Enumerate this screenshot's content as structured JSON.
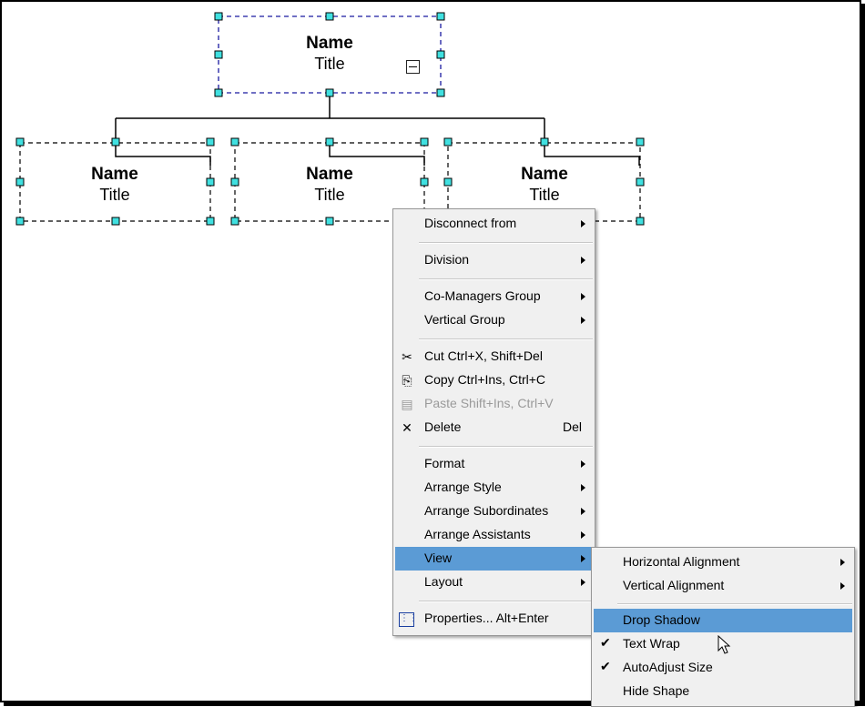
{
  "org_chart": {
    "top_node": {
      "name": "Name",
      "title": "Title"
    },
    "children": [
      {
        "name": "Name",
        "title": "Title"
      },
      {
        "name": "Name",
        "title": "Title"
      },
      {
        "name": "Name",
        "title": "Title"
      }
    ]
  },
  "context_menu": {
    "items": {
      "disconnect": "Disconnect from",
      "division": "Division",
      "co_managers": "Co-Managers Group",
      "vertical_group": "Vertical Group",
      "cut": "Cut  Ctrl+X, Shift+Del",
      "copy": "Copy  Ctrl+Ins, Ctrl+C",
      "paste": "Paste Shift+Ins, Ctrl+V",
      "delete": "Delete",
      "delete_shortcut": "Del",
      "format": "Format",
      "arrange_style": "Arrange Style",
      "arrange_subordinates": "Arrange Subordinates",
      "arrange_assistants": "Arrange Assistants",
      "view": "View",
      "layout": "Layout",
      "properties": "Properties...  Alt+Enter"
    }
  },
  "view_submenu": {
    "items": {
      "horizontal_alignment": "Horizontal Alignment",
      "vertical_alignment": "Vertical Alignment",
      "drop_shadow": "Drop Shadow",
      "text_wrap": "Text Wrap",
      "autoadjust_size": "AutoAdjust Size",
      "hide_shape": "Hide Shape"
    },
    "checked": [
      "text_wrap",
      "autoadjust_size"
    ]
  },
  "colors": {
    "highlight": "#5b9bd5",
    "handle": "#40e0e0",
    "selection_border": "#1a1aa0"
  },
  "icons": [
    "cut-icon",
    "copy-icon",
    "paste-icon",
    "delete-icon",
    "properties-icon",
    "check-icon",
    "mouse-cursor-icon"
  ]
}
